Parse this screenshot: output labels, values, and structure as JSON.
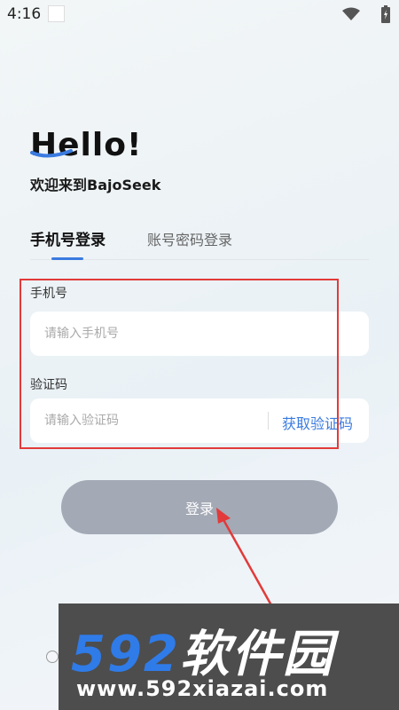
{
  "status_bar": {
    "time": "4:16",
    "icons": [
      "wifi-icon",
      "battery-icon"
    ]
  },
  "header": {
    "hello": "Hello!",
    "welcome": "欢迎来到BajoSeek"
  },
  "tabs": [
    {
      "label": "手机号登录",
      "active": true
    },
    {
      "label": "账号密码登录",
      "active": false
    }
  ],
  "form": {
    "phone_label": "手机号",
    "phone_placeholder": "请输入手机号",
    "code_label": "验证码",
    "code_placeholder": "请输入验证码",
    "get_code_label": "获取验证码"
  },
  "login_button_label": "登录",
  "watermark": {
    "brand_number": "592",
    "brand_name": "软件园",
    "url": "www.592xiazai.com"
  },
  "colors": {
    "accent": "#3a7be0",
    "button": "#a3a9b5",
    "highlight": "#e23a3a"
  }
}
